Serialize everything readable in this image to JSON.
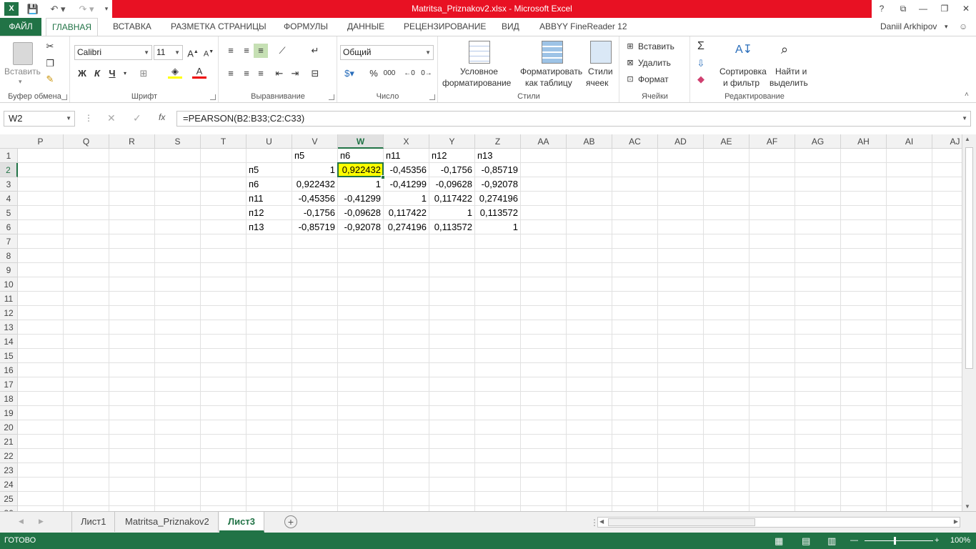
{
  "title": "Matritsa_Priznakov2.xlsx -  Microsoft Excel",
  "window_controls": {
    "help": "?",
    "restore_ribbon": "⧉",
    "minimize": "—",
    "maximize": "❐",
    "close": "✕"
  },
  "tabs": {
    "file": "ФАЙЛ",
    "home": "ГЛАВНАЯ",
    "insert": "ВСТАВКА",
    "layout": "РАЗМЕТКА СТРАНИЦЫ",
    "formulas": "ФОРМУЛЫ",
    "data": "ДАННЫЕ",
    "review": "РЕЦЕНЗИРОВАНИЕ",
    "view": "ВИД",
    "abbyy": "ABBYY FineReader 12"
  },
  "user": "Daniil Arkhipov",
  "ribbon": {
    "clipboard": {
      "label": "Буфер обмена",
      "paste": "Вставить"
    },
    "font": {
      "label": "Шрифт",
      "name": "Calibri",
      "size": "11",
      "bold": "Ж",
      "italic": "К",
      "underline": "Ч"
    },
    "alignment": {
      "label": "Выравнивание"
    },
    "number": {
      "label": "Число",
      "format": "Общий",
      "percent": "%",
      "thousands": "000"
    },
    "styles": {
      "label": "Стили",
      "cond1": "Условное",
      "cond2": "форматирование",
      "table1": "Форматировать",
      "table2": "как таблицу",
      "cell1": "Стили",
      "cell2": "ячеек"
    },
    "cells": {
      "label": "Ячейки",
      "insert": "Вставить",
      "delete": "Удалить",
      "format": "Формат"
    },
    "editing": {
      "label": "Редактирование",
      "sort1": "Сортировка",
      "sort2": "и фильтр",
      "find1": "Найти и",
      "find2": "выделить"
    }
  },
  "formula_bar": {
    "name_box": "W2",
    "formula": "=PEARSON(B2:B33;C2:C33)",
    "fx": "fx"
  },
  "columns": [
    "P",
    "Q",
    "R",
    "S",
    "T",
    "U",
    "V",
    "W",
    "X",
    "Y",
    "Z",
    "AA",
    "AB",
    "AC",
    "AD",
    "AE",
    "AF",
    "AG",
    "AH",
    "AI",
    "AJ"
  ],
  "rows": [
    "1",
    "2",
    "3",
    "4",
    "5",
    "6",
    "7",
    "8",
    "9",
    "10",
    "11",
    "12",
    "13",
    "14",
    "15",
    "16",
    "17",
    "18",
    "19",
    "20",
    "21",
    "22",
    "23",
    "24",
    "25",
    "26"
  ],
  "matrix": {
    "headers": [
      "п5",
      "п6",
      "п11",
      "п12",
      "п13"
    ],
    "rows": [
      {
        "label": "п5",
        "values": [
          "1",
          "0,922432",
          "-0,45356",
          "-0,1756",
          "-0,85719"
        ]
      },
      {
        "label": "п6",
        "values": [
          "0,922432",
          "1",
          "-0,41299",
          "-0,09628",
          "-0,92078"
        ]
      },
      {
        "label": "п11",
        "values": [
          "-0,45356",
          "-0,41299",
          "1",
          "0,117422",
          "0,274196"
        ]
      },
      {
        "label": "п12",
        "values": [
          "-0,1756",
          "-0,09628",
          "0,117422",
          "1",
          "0,113572"
        ]
      },
      {
        "label": "п13",
        "values": [
          "-0,85719",
          "-0,92078",
          "0,274196",
          "0,113572",
          "1"
        ]
      }
    ]
  },
  "sheets": [
    "Лист1",
    "Matritsa_Priznakov2",
    "Лист3"
  ],
  "active_sheet": "Лист3",
  "status": {
    "ready": "ГОТОВО",
    "zoom": "100%"
  },
  "colors": {
    "accent": "#217346",
    "title_bar": "#e81123",
    "selected_fill": "#ffff00"
  }
}
